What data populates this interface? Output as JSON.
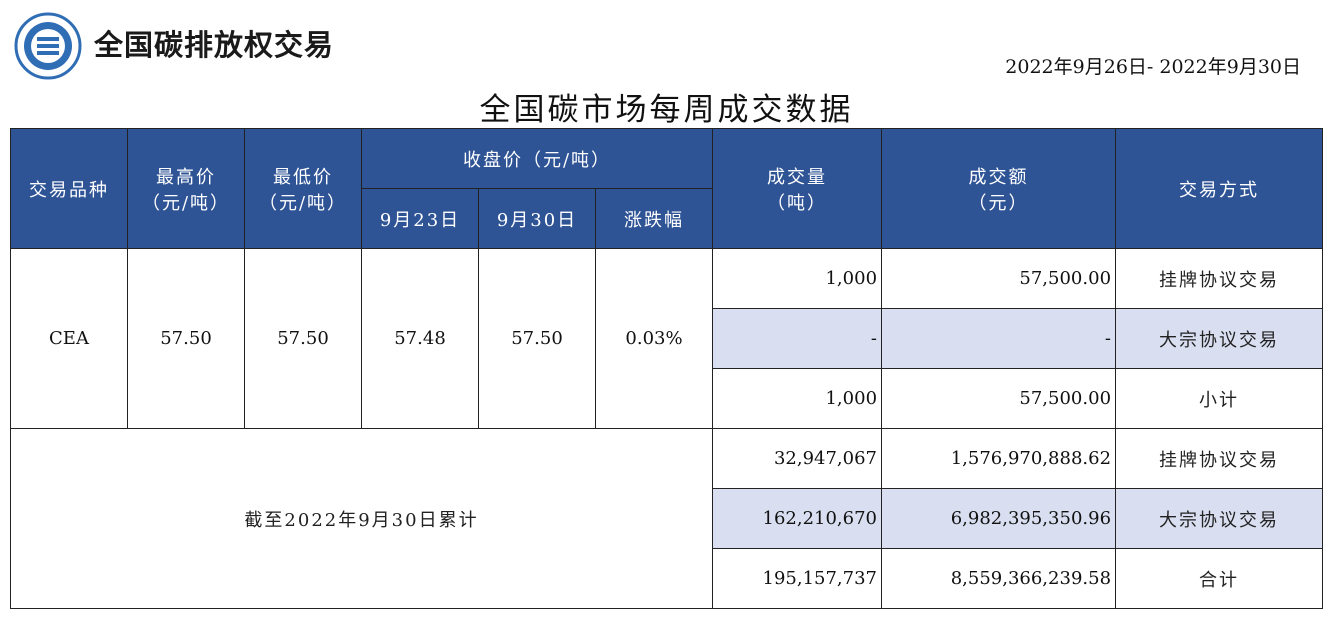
{
  "header": {
    "brand": "全国碳排放权交易",
    "date_range": "2022年9月26日- 2022年9月30日"
  },
  "title": "全国碳市场每周成交数据",
  "columns": {
    "product": "交易品种",
    "high_1": "最高价",
    "high_2": "（元/吨）",
    "low_1": "最低价",
    "low_2": "（元/吨）",
    "close": "收盘价（元/吨）",
    "close_prev": "9月23日",
    "close_curr": "9月30日",
    "change": "涨跌幅",
    "volume_1": "成交量",
    "volume_2": "（吨）",
    "amount_1": "成交额",
    "amount_2": "（元）",
    "method": "交易方式"
  },
  "weekly": {
    "product": "CEA",
    "high": "57.50",
    "low": "57.50",
    "close_prev": "57.48",
    "close_curr": "57.50",
    "change": "0.03%",
    "rows": [
      {
        "volume": "1,000",
        "amount": "57,500.00",
        "method": "挂牌协议交易"
      },
      {
        "volume": "-",
        "amount": "-",
        "method": "大宗协议交易"
      },
      {
        "volume": "1,000",
        "amount": "57,500.00",
        "method": "小计"
      }
    ]
  },
  "cumulative": {
    "label": "截至2022年9月30日累计",
    "rows": [
      {
        "volume": "32,947,067",
        "amount": "1,576,970,888.62",
        "method": "挂牌协议交易"
      },
      {
        "volume": "162,210,670",
        "amount": "6,982,395,350.96",
        "method": "大宗协议交易"
      },
      {
        "volume": "195,157,737",
        "amount": "8,559,366,239.58",
        "method": "合计"
      }
    ]
  },
  "colors": {
    "header_bg": "#2f5496",
    "shade_bg": "#d9dff0",
    "logo_blue": "#2f6db5"
  }
}
